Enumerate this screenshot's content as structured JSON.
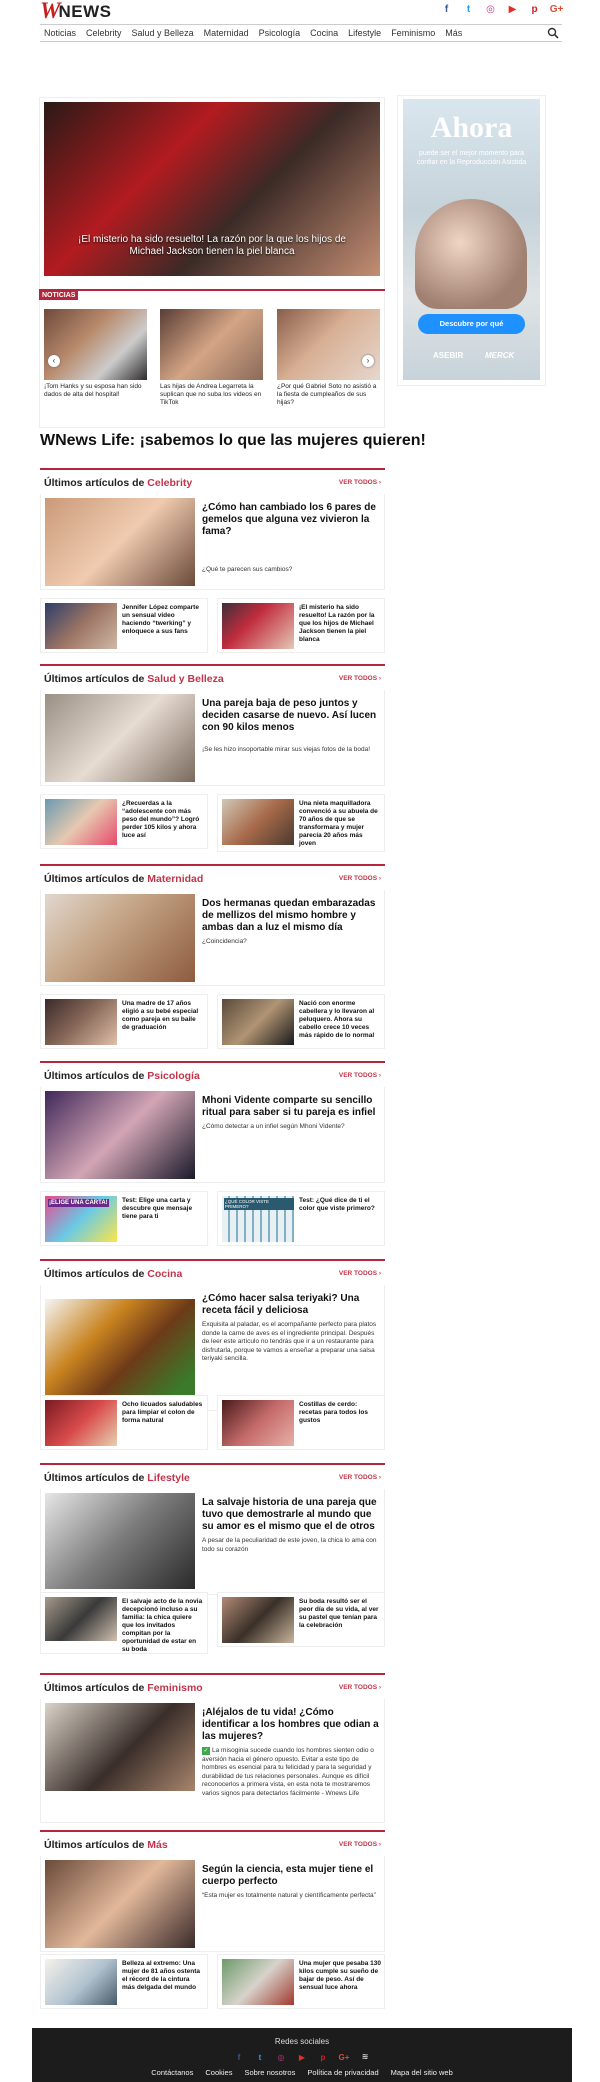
{
  "header": {
    "logo_w": "W",
    "logo_text": "NEWS",
    "social_icons": [
      {
        "name": "facebook-icon",
        "glyph": "f",
        "color": "#3b5998"
      },
      {
        "name": "twitter-icon",
        "glyph": "t",
        "color": "#1da1f2"
      },
      {
        "name": "instagram-icon",
        "glyph": "◎",
        "color": "#c13584"
      },
      {
        "name": "youtube-icon",
        "glyph": "▶",
        "color": "#e52d27"
      },
      {
        "name": "pinterest-icon",
        "glyph": "p",
        "color": "#cb2027"
      },
      {
        "name": "googleplus-icon",
        "glyph": "G+",
        "color": "#dd4b39"
      }
    ]
  },
  "nav": {
    "items": [
      "Noticias",
      "Celebrity",
      "Salud y Belleza",
      "Maternidad",
      "Psicología",
      "Cocina",
      "Lifestyle",
      "Feminismo",
      "Más"
    ]
  },
  "hero": {
    "caption": "¡El misterio ha sido resuelto! La razón por la que los hijos de Michael Jackson tienen la piel blanca"
  },
  "noticias": {
    "tag": "NOTICIAS",
    "items": [
      "¡Tom Hanks y su esposa han sido dados de alta del hospital!",
      "Las hijas de Andrea Legarreta la suplican que no suba los videos en TikTok",
      "¿Por qué Gabriel Soto no asistió a la fiesta de cumpleaños de sus hijas?"
    ],
    "prev": "‹",
    "next": "›"
  },
  "ad": {
    "headline": "Ahora",
    "text": "puede ser el mejor momento para confiar en la Reproducción Asistida",
    "button": "Descubre por qué",
    "brand1": "ASEBIR",
    "brand2": "MERCK"
  },
  "mission": "WNews Life: ¡sabemos lo que las mujeres quieren!",
  "section_prefix": "Últimos artículos de",
  "see_all": "VER TODOS ›",
  "sections": [
    {
      "category": "Celebrity",
      "main_title": "¿Cómo han cambiado los 6 pares de gemelos que alguna vez vivieron la fama?",
      "main_sub": "¿Qué te parecen sus cambios?",
      "small": [
        "Jennifer López comparte un sensual video haciendo “twerking” y enloquece a sus fans",
        "¡El misterio ha sido resuelto! La razón por la que los hijos de Michael Jackson tienen la piel blanca"
      ]
    },
    {
      "category": "Salud y Belleza",
      "main_title": "Una pareja baja de peso juntos y deciden casarse de nuevo. Así lucen con 90 kilos menos",
      "main_sub": "¡Se les hizo insoportable mirar sus viejas fotos de la boda!",
      "small": [
        "¿Recuerdas a la “adolescente con más peso del mundo”? Logró perder 105 kilos y ahora luce así",
        "Una nieta maquilladora convenció a su abuela de 70 años de que se transformara y mujer parecía 20 años más joven"
      ]
    },
    {
      "category": "Maternidad",
      "main_title": "Dos hermanas quedan embarazadas de mellizos del mismo hombre y ambas dan a luz el mismo día",
      "main_sub": "¿Coincidencia?",
      "small": [
        "Una madre de 17 años eligió a su bebé especial como pareja en su baile de graduación",
        "Nació con enorme cabellera y lo llevaron al peluquero. Ahora su cabello crece 10 veces más rápido de lo normal"
      ]
    },
    {
      "category": "Psicología",
      "main_title": "Mhoni Vidente comparte su sencillo ritual para saber si tu pareja es infiel",
      "main_sub": "¿Cómo detectar a un infiel según Mhoni Vidente?",
      "small": [
        "Test: Elige una carta y descubre que mensaje tiene para ti",
        "Test: ¿Qué dice de ti el color que viste primero?"
      ],
      "small_overlays": [
        "¡ELIGE UNA CARTA!",
        "¿QUÉ COLOR VISTE PRIMERO?"
      ]
    },
    {
      "category": "Cocina",
      "main_title": "¿Cómo hacer salsa teriyaki? Una receta fácil y deliciosa",
      "main_sub": "Exquisita al paladar, es el acompañante perfecto para platos donde la carne de aves es el ingrediente principal. Después de leer este artículo no tendrás que ir a un restaurante para disfrutarla, porque te vamos a enseñar a preparar una salsa teriyaki sencilla.",
      "small": [
        "Ocho licuados saludables para limpiar el colon de forma natural",
        "Costillas de cerdo: recetas para todos los gustos"
      ]
    },
    {
      "category": "Lifestyle",
      "main_title": "La salvaje historia de una pareja que tuvo que demostrarle al mundo que su amor es el mismo que el de otros",
      "main_sub": "A pesar de la peculiaridad de este joven, la chica lo ama con todo su corazón",
      "small": [
        "El salvaje acto de la novia decepcionó incluso a su familia: la chica quiere que los invitados compitan por la oportunidad de estar en su boda",
        "Su boda resultó ser el peor día de su vida, al ver su pastel que tenían para la celebración"
      ]
    },
    {
      "category": "Feminismo",
      "main_title": "¡Aléjalos de tu vida! ¿Cómo identificar a los hombres que odian a las mujeres?",
      "main_sub": "La misoginia sucede cuando los hombres sienten odio o aversión hacia el género opuesto. Evitar a este tipo de hombres es esencial para tu felicidad y para la seguridad y durabilidad de tus relaciones personales. Aunque es difícil reconocerlos a primera vista, en esta nota te mostraremos varios signos para detectarlos fácilmente - Wnews Life",
      "check": "✓"
    },
    {
      "category": "Más",
      "main_title": "Según la ciencia, esta mujer tiene el cuerpo perfecto",
      "main_sub": "“Esta mujer es totalmente natural y científicamente perfecta”",
      "small": [
        "Belleza al extremo: Una mujer de 81 años ostenta el récord de la cintura más delgada del mundo",
        "Una mujer que pesaba 130 kilos cumple su sueño de bajar de peso. Así de sensual luce ahora"
      ]
    }
  ],
  "footer": {
    "title": "Redes sociales",
    "links": [
      "Contáctanos",
      "Cookies",
      "Sobre nosotros",
      "Política de privacidad",
      "Mapa del sitio web"
    ]
  }
}
